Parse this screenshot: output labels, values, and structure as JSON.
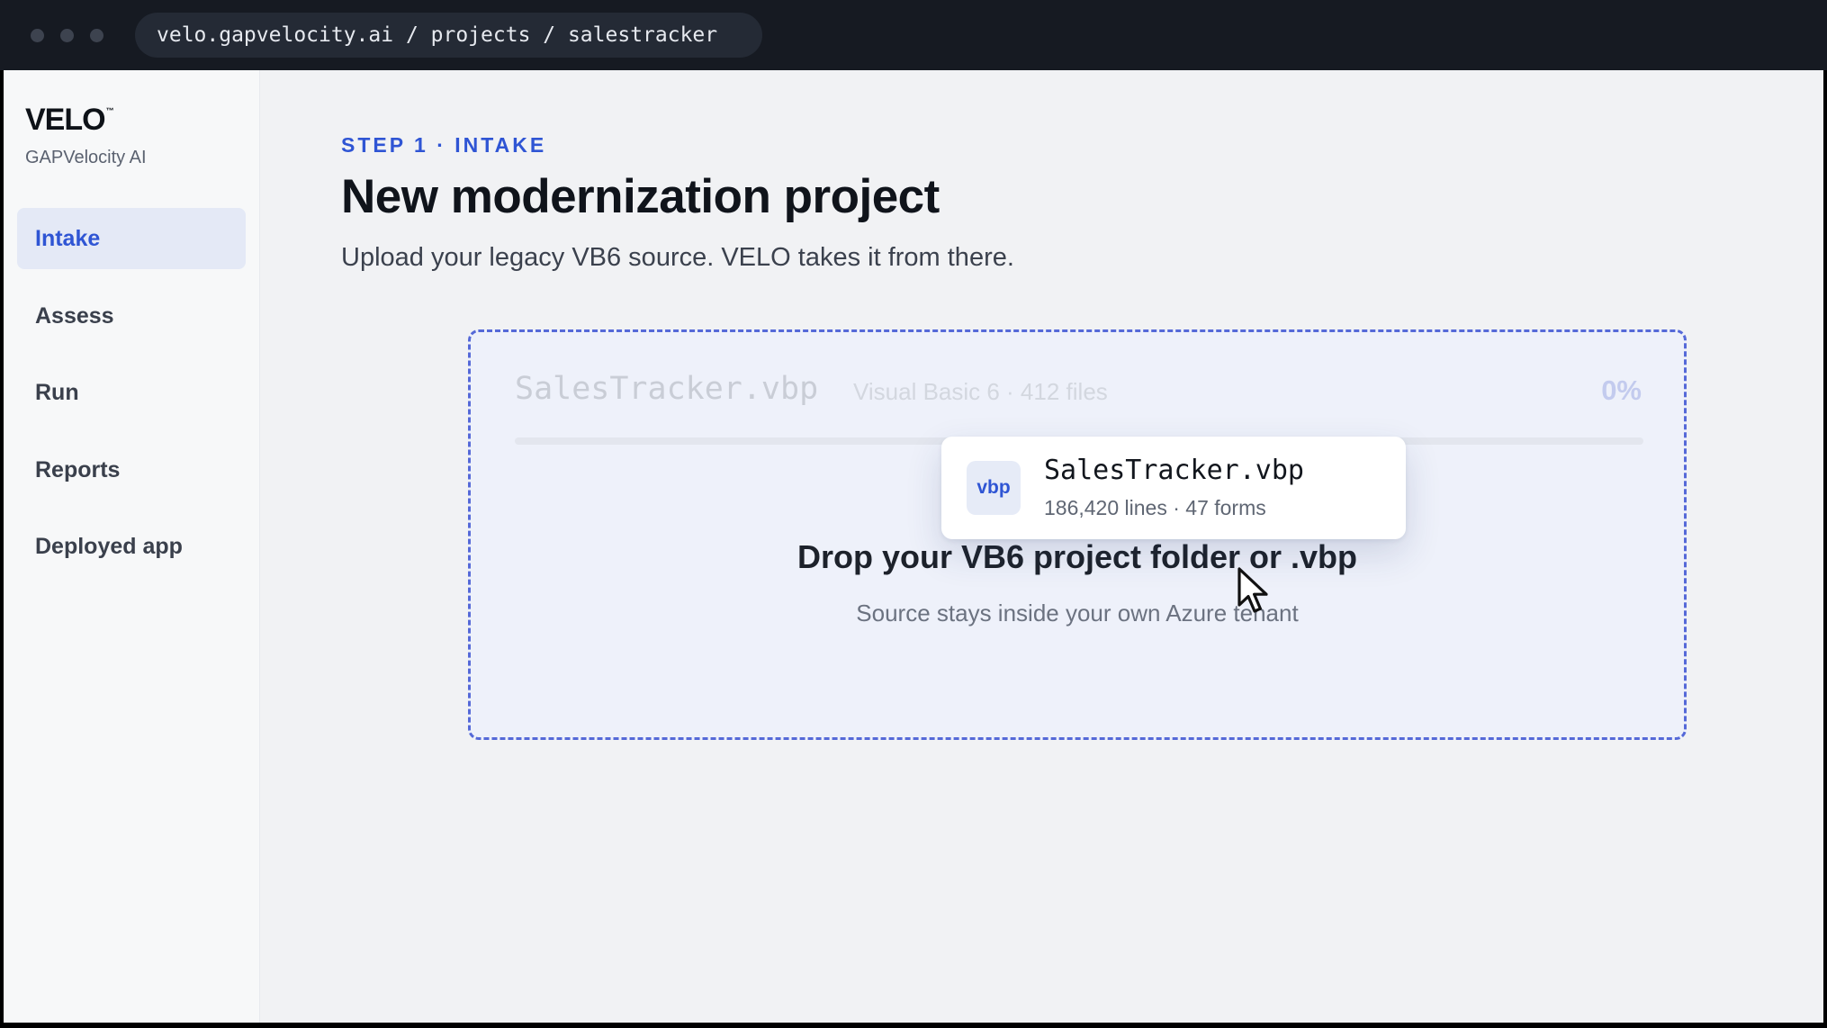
{
  "browser": {
    "url": "velo.gapvelocity.ai / projects / salestracker"
  },
  "sidebar": {
    "logo": "VELO",
    "logo_mark": "™",
    "org": "GAPVelocity AI",
    "items": [
      {
        "label": "Intake",
        "active": true
      },
      {
        "label": "Assess",
        "active": false
      },
      {
        "label": "Run",
        "active": false
      },
      {
        "label": "Reports",
        "active": false
      },
      {
        "label": "Deployed app",
        "active": false
      }
    ]
  },
  "main": {
    "eyebrow": "STEP 1 · INTAKE",
    "title": "New modernization project",
    "subtitle": "Upload your legacy VB6 source. VELO takes it from there."
  },
  "dropzone": {
    "ghost_name": "SalesTracker.vbp",
    "ghost_meta": "Visual Basic 6 · 412 files",
    "ghost_progress": "0%",
    "title": "Drop your VB6 project folder or .vbp",
    "subtitle": "Source stays inside your own Azure tenant"
  },
  "file_card": {
    "badge": "vbp",
    "name": "SalesTracker.vbp",
    "meta": "186,420 lines · 47 forms"
  },
  "colors": {
    "accent": "#2f55d4",
    "topbar": "#161a22",
    "dropzone_border": "#5569d8"
  },
  "icons": {
    "cursor": "arrow-cursor-icon"
  }
}
